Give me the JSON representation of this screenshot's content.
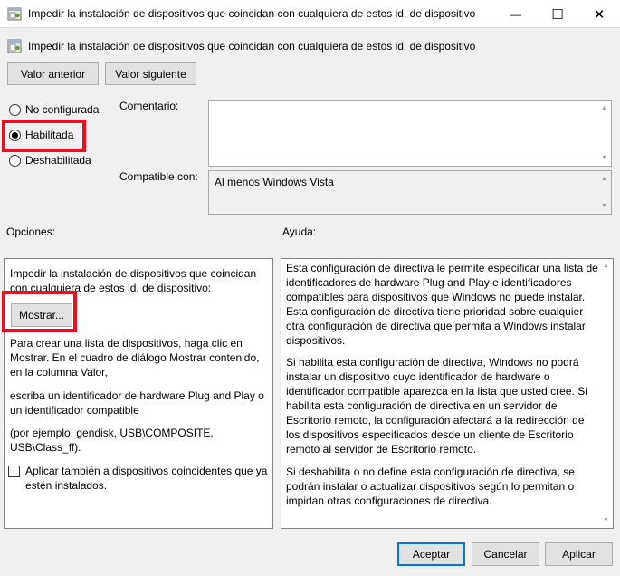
{
  "window": {
    "title": "Impedir la instalación de dispositivos que coincidan con cualquiera de estos id. de dispositivo",
    "minimize_glyph": "—",
    "maximize_glyph": "☐",
    "close_glyph": "✕"
  },
  "header": {
    "title": "Impedir la instalación de dispositivos que coincidan con cualquiera de estos id. de dispositivo"
  },
  "nav": {
    "previous_label": "Valor anterior",
    "next_label": "Valor siguiente"
  },
  "state": {
    "options": [
      {
        "label": "No configurada",
        "selected": false
      },
      {
        "label": "Habilitada",
        "selected": true
      },
      {
        "label": "Deshabilitada",
        "selected": false
      }
    ]
  },
  "comment": {
    "label": "Comentario:",
    "value": ""
  },
  "compatible": {
    "label": "Compatible con:",
    "value": "Al menos Windows Vista"
  },
  "options_panel": {
    "heading": "Opciones:",
    "line1": "Impedir la instalación de dispositivos que coincidan",
    "line2": "con cualquiera de estos id. de dispositivo:",
    "show_button": "Mostrar...",
    "para1": "Para crear una lista de dispositivos, haga clic en Mostrar. En el cuadro de diálogo Mostrar contenido, en la columna Valor,",
    "para2": "escriba un identificador de hardware Plug and Play o un identificador compatible",
    "para3": "(por ejemplo, gendisk, USB\\COMPOSITE, USB\\Class_ff).",
    "checkbox_label": "Aplicar también a dispositivos coincidentes que ya estén instalados.",
    "checkbox_checked": false
  },
  "help_panel": {
    "heading": "Ayuda:",
    "para1": "Esta configuración de directiva le permite especificar una lista de identificadores de hardware Plug and Play e identificadores compatibles para dispositivos que Windows no puede instalar. Esta configuración de directiva tiene prioridad sobre cualquier otra configuración de directiva que permita a Windows instalar dispositivos.",
    "para2": "Si habilita esta configuración de directiva, Windows no podrá instalar un dispositivo cuyo identificador de hardware o identificador compatible aparezca en la lista que usted cree. Si habilita esta configuración de directiva en un servidor de Escritorio remoto, la configuración afectará a la redirección de los dispositivos especificados desde un cliente de Escritorio remoto al servidor de Escritorio remoto.",
    "para3": "Si deshabilita o no define esta configuración de directiva, se podrán instalar o actualizar dispositivos según lo permitan o impidan otras configuraciones de directiva."
  },
  "footer": {
    "ok_label": "Aceptar",
    "cancel_label": "Cancelar",
    "apply_label": "Aplicar"
  },
  "colors": {
    "highlight_red": "#e81123",
    "focus_blue": "#0078d7"
  },
  "icons": {
    "window": "policy-setting-icon",
    "header": "policy-setting-icon"
  }
}
